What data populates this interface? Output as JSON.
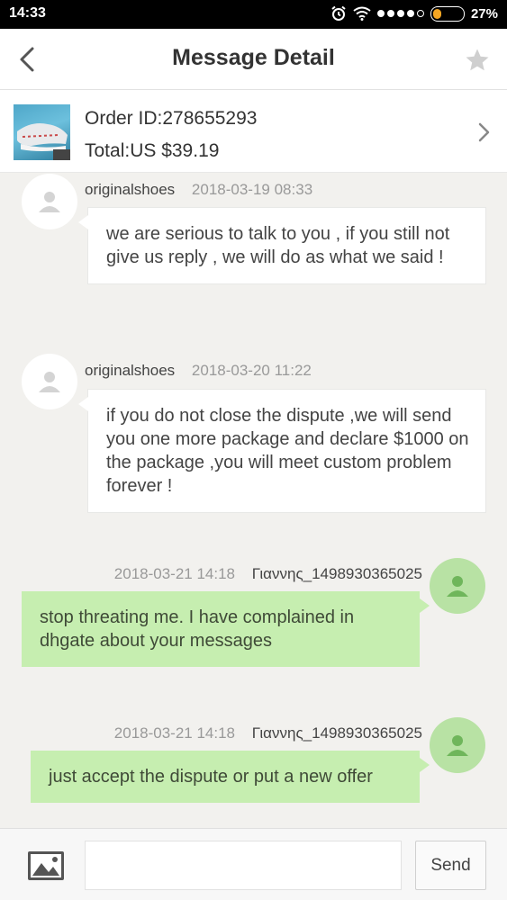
{
  "status_bar": {
    "time": "14:33",
    "battery": "27%",
    "battery_level": 0.27,
    "signal_bars": 4,
    "signal_total": 5
  },
  "header": {
    "title": "Message Detail"
  },
  "order": {
    "id_text": "Order ID:278655293",
    "total_text": "Total:US $39.19"
  },
  "messages": [
    {
      "sender": "originalshoes",
      "datetime": "2018-03-19 08:33",
      "text": "we are serious to talk to you , if you still not give us reply , we will do as what we said !",
      "direction": "incoming"
    },
    {
      "sender": "originalshoes",
      "datetime": "2018-03-20 11:22",
      "text": "if you do not close the dispute ,we will send you one more package and declare $1000 on the package ,you will meet custom problem forever !",
      "direction": "incoming"
    },
    {
      "sender": "Γιαννης_1498930365025",
      "datetime": "2018-03-21 14:18",
      "text": "stop threating me. I have complained in dhgate about your messages",
      "direction": "outgoing"
    },
    {
      "sender": "Γιαννης_1498930365025",
      "datetime": "2018-03-21 14:18",
      "text": "just accept the dispute or put a new offer",
      "direction": "outgoing"
    }
  ],
  "footer": {
    "input_value": "",
    "send_label": "Send"
  },
  "icons": {
    "back": "chevron-left-icon",
    "favorite": "star-icon",
    "order_arrow": "chevron-right-icon",
    "avatar": "user-icon",
    "attach": "image-icon",
    "alarm": "alarm-clock-icon",
    "wifi": "wifi-icon"
  },
  "colors": {
    "outgoing_bubble": "#c6eeb0",
    "outgoing_avatar": "#b8e2a4",
    "battery_fill": "#f5a623",
    "background": "#f2f1ee"
  }
}
